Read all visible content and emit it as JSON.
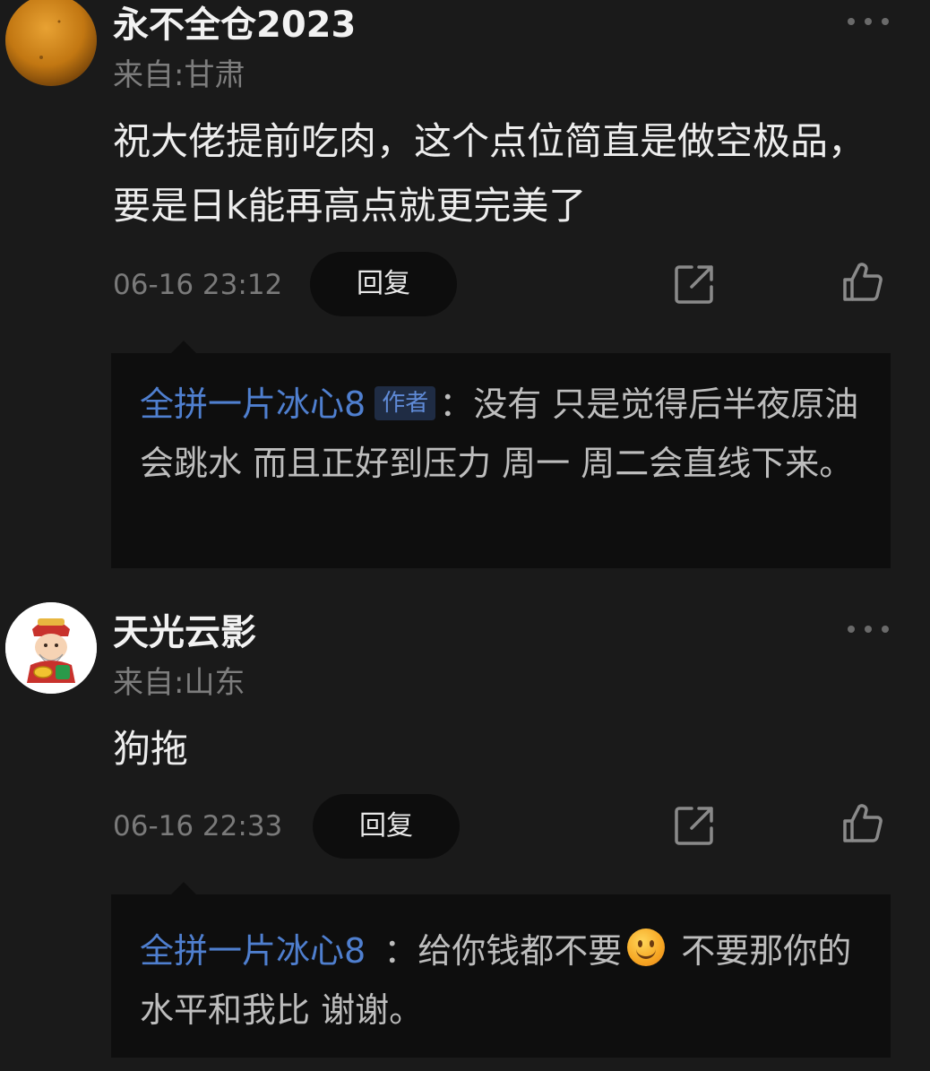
{
  "comments": [
    {
      "username": "永不全仓2023",
      "location": "来自:甘肃",
      "content": "祝大佬提前吃肉，这个点位简直是做空极品，要是日k能再高点就更完美了",
      "timestamp": "06-16 23:12",
      "reply_label": "回复",
      "avatar_icon": "orange-avatar-icon",
      "reply": {
        "author": "全拼一片冰心8",
        "author_tag": "作者",
        "separator": "：",
        "text": "没有 只是觉得后半夜原油会跳水 而且正好到压力  周一 周二会直线下来。"
      }
    },
    {
      "username": "天光云影",
      "location": "来自:山东",
      "content": "狗拖",
      "timestamp": "06-16 22:33",
      "reply_label": "回复",
      "avatar_icon": "fortune-god-avatar-icon",
      "reply": {
        "author": "全拼一片冰心8",
        "separator": "：",
        "text_before_emoji": "给你钱都不要",
        "emoji": "smile-emoji-icon",
        "text_after_emoji": " 不要那你的水平和我比 谢谢。"
      }
    }
  ],
  "colors": {
    "background": "#1a1a1a",
    "reply_box": "#0e0e0e",
    "author_link": "#4f7fcf",
    "muted_text": "#7a7a7a"
  }
}
